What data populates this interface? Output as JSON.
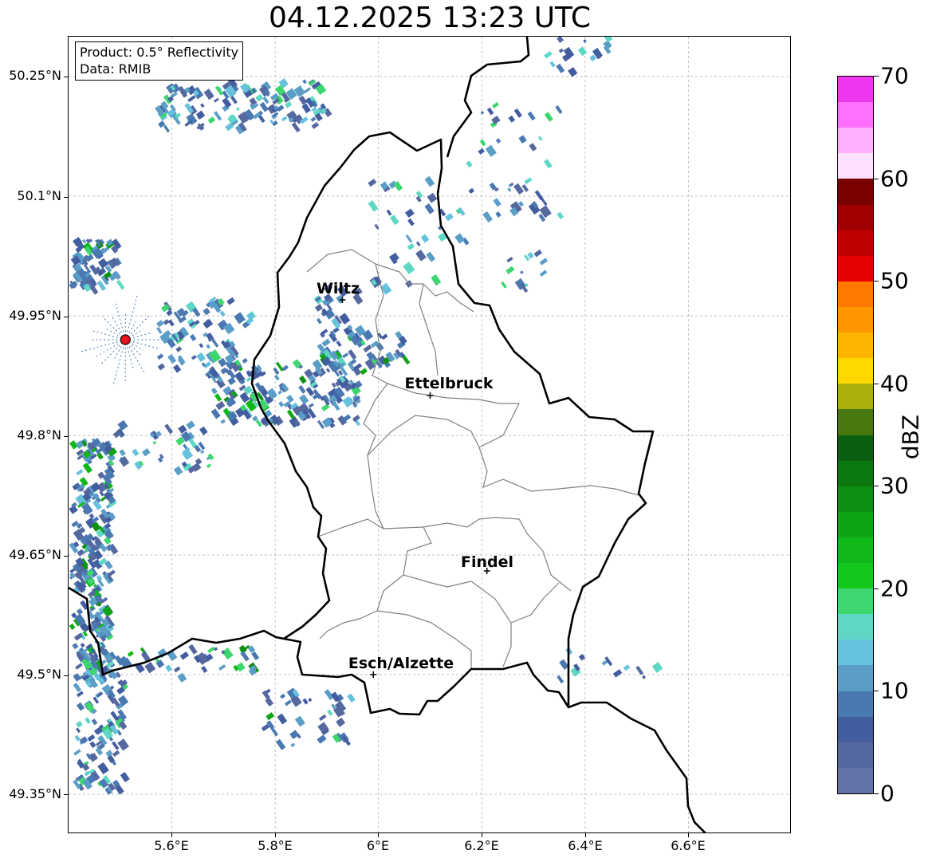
{
  "title": "04.12.2025 13:23 UTC",
  "info": {
    "product": "Product: 0.5° Reflectivity",
    "data": "Data: RMIB"
  },
  "axes": {
    "y_ticks": [
      "50.25°N",
      "50.1°N",
      "49.95°N",
      "49.8°N",
      "49.65°N",
      "49.5°N",
      "49.35°N"
    ],
    "x_ticks": [
      "5.6°E",
      "5.8°E",
      "6°E",
      "6.2°E",
      "6.4°E",
      "6.6°E"
    ],
    "lon_range": [
      5.4,
      6.8
    ],
    "lat_range": [
      49.3,
      50.3
    ]
  },
  "cities": [
    {
      "name": "Wiltz",
      "lon": 5.93,
      "lat": 49.97
    },
    {
      "name": "Ettelbruck",
      "lon": 6.1,
      "lat": 49.85
    },
    {
      "name": "Findel",
      "lon": 6.21,
      "lat": 49.63
    },
    {
      "name": "Esch/Alzette",
      "lon": 5.99,
      "lat": 49.5
    }
  ],
  "radar_site": {
    "lon": 5.51,
    "lat": 49.92,
    "color": "#e8141e"
  },
  "colorbar": {
    "label": "dBZ",
    "ticks": [
      "0",
      "10",
      "20",
      "30",
      "40",
      "50",
      "60",
      "70"
    ],
    "range": [
      0,
      70
    ],
    "colors": [
      "#6373a8",
      "#55689f",
      "#435ea0",
      "#4a78b0",
      "#5a9ec8",
      "#66c2dc",
      "#5ed7c4",
      "#3ed66e",
      "#14c81e",
      "#10b81a",
      "#0fa416",
      "#0d8f12",
      "#0b7810",
      "#0b5f10",
      "#48780f",
      "#a9b00b",
      "#ffd800",
      "#ffb400",
      "#ff9600",
      "#ff7800",
      "#e60000",
      "#c00000",
      "#a00000",
      "#7a0000",
      "#ffe0ff",
      "#ffb0ff",
      "#ff70ff",
      "#ee36ee"
    ]
  },
  "colors": {
    "border": "#000000",
    "canton": "#808080",
    "grid": "#aaaaaa"
  }
}
